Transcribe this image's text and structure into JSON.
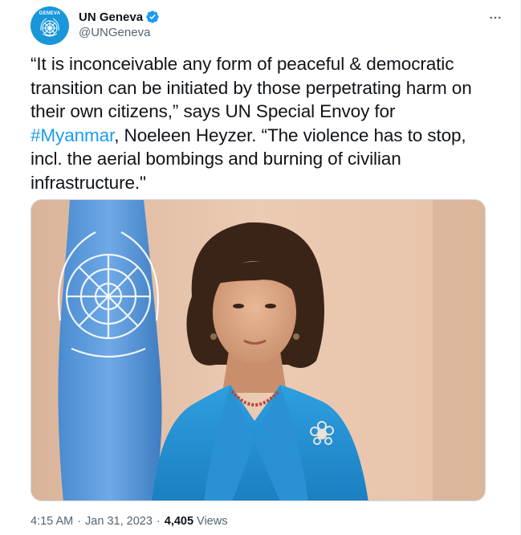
{
  "author": {
    "display_name": "UN Geneva",
    "handle": "@UNGeneva",
    "avatar_text": "GENEVA",
    "verified": true
  },
  "tweet": {
    "text_before": "“It is inconceivable any form of peaceful & democratic transition can be initiated by those perpetrating harm on their own citizens,” says UN Special Envoy for ",
    "hashtag": "#Myanmar",
    "text_after": ", Noeleen Heyzer. “The violence has to stop, incl. the aerial bombings and burning of civilian infrastructure.\""
  },
  "meta": {
    "time": "4:15 AM",
    "date": "Jan 31, 2023",
    "separator": "·",
    "views_count": "4,405",
    "views_label": "Views"
  },
  "icons": {
    "more": "more-horizontal-icon",
    "verified": "verified-badge-icon"
  },
  "colors": {
    "link": "#1d9bf0",
    "secondary_text": "#536471",
    "primary_text": "#0f1419",
    "avatar_bg": "#1a96da"
  }
}
